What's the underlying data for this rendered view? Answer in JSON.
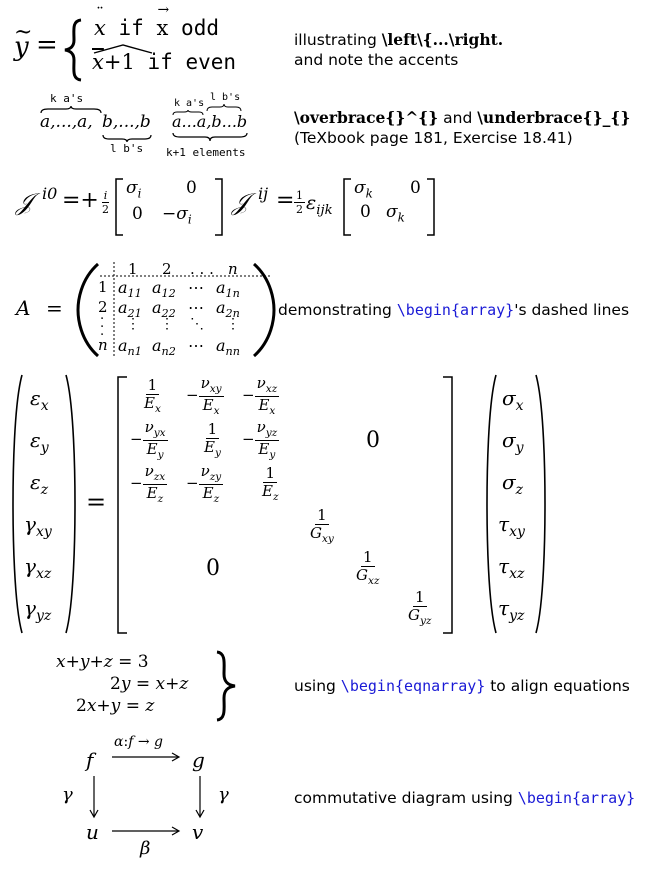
{
  "block1": {
    "case1_cond": "if",
    "case1_rest": "odd",
    "case2_cond": "if",
    "case2_rest": "even",
    "desc_prefix": "illustrating ",
    "desc_cmd": "\\left\\{...\\right.",
    "desc_line2": "and note the accents"
  },
  "block2": {
    "over1_label": "k a's",
    "under1_label": "l b's",
    "over2_label": "k a's",
    "over3_label": "l b's",
    "under2_label": "k+1 elements",
    "desc_cmd1": "\\overbrace{}^{}",
    "desc_and": " and ",
    "desc_cmd2": "\\underbrace{}_{}",
    "desc_line2": "(TeXbook page 181, Exercise 18.41)"
  },
  "block4": {
    "desc_prefix": "demonstrating ",
    "desc_cmd": "\\begin{array}",
    "desc_suffix": "'s dashed lines"
  },
  "block6": {
    "desc_prefix": "using ",
    "desc_cmd": "\\begin{eqnarray}",
    "desc_suffix": " to align equations"
  },
  "block7": {
    "desc_prefix": "commutative diagram using ",
    "desc_cmd": "\\begin{array}"
  }
}
